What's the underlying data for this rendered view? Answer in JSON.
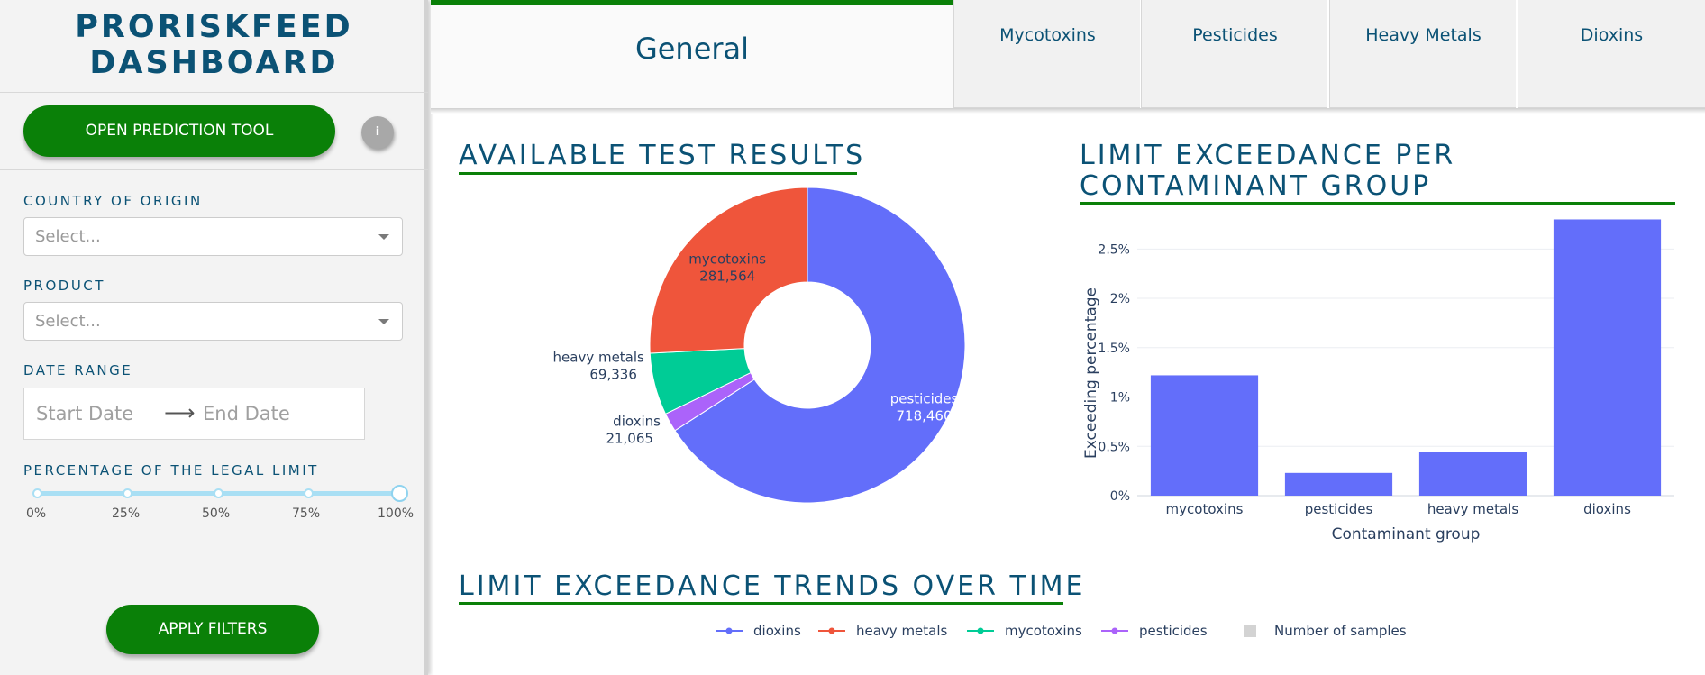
{
  "sidebar": {
    "brand_line1": "PRORISKFEED",
    "brand_line2": "DASHBOARD",
    "prediction_button": "OPEN PREDICTION TOOL",
    "info_label": "i",
    "country": {
      "label": "COUNTRY OF ORIGIN",
      "placeholder": "Select..."
    },
    "product": {
      "label": "PRODUCT",
      "placeholder": "Select..."
    },
    "date_range": {
      "label": "DATE RANGE",
      "start_placeholder": "Start Date",
      "end_placeholder": "End Date"
    },
    "legal_limit": {
      "label": "PERCENTAGE OF THE LEGAL LIMIT",
      "marks": [
        "0%",
        "25%",
        "50%",
        "75%",
        "100%"
      ],
      "value": 100
    },
    "apply_button": "APPLY FILTERS"
  },
  "tabs": [
    {
      "label": "General",
      "active": true
    },
    {
      "label": "Mycotoxins",
      "active": false
    },
    {
      "label": "Pesticides",
      "active": false
    },
    {
      "label": "Heavy Metals",
      "active": false
    },
    {
      "label": "Dioxins",
      "active": false
    }
  ],
  "sections": {
    "available_results": "AVAILABLE TEST RESULTS",
    "exceedance_line1": "LIMIT EXCEEDANCE PER",
    "exceedance_line2": "CONTAMINANT GROUP",
    "trends": "LIMIT EXCEEDANCE TRENDS OVER TIME"
  },
  "colors": {
    "brand": "#0b5275",
    "accent_green": "#0a8008",
    "dioxins": "#636efa",
    "heavy_metals": "#ef553b",
    "mycotoxins": "#00cc96",
    "pesticides": "#ab63fa",
    "bar": "#636efa",
    "samples": "#d3d3d3"
  },
  "trend_legend": [
    {
      "label": "dioxins",
      "color": "#636efa",
      "kind": "line"
    },
    {
      "label": "heavy metals",
      "color": "#ef553b",
      "kind": "line"
    },
    {
      "label": "mycotoxins",
      "color": "#00cc96",
      "kind": "line"
    },
    {
      "label": "pesticides",
      "color": "#ab63fa",
      "kind": "line"
    },
    {
      "label": "Number of samples",
      "color": "#d3d3d3",
      "kind": "square"
    }
  ],
  "chart_data": [
    {
      "type": "pie",
      "hole": true,
      "title": "",
      "slices": [
        {
          "label": "pesticides",
          "value": 718460,
          "display": "718,460",
          "color": "#636efa"
        },
        {
          "label": "dioxins",
          "value": 21065,
          "display": "21,065",
          "color": "#ab63fa"
        },
        {
          "label": "heavy metals",
          "value": 69336,
          "display": "69,336",
          "color": "#00cc96"
        },
        {
          "label": "mycotoxins",
          "value": 281564,
          "display": "281,564",
          "color": "#ef553b"
        }
      ]
    },
    {
      "type": "bar",
      "title": "",
      "categories": [
        "mycotoxins",
        "pesticides",
        "heavy metals",
        "dioxins"
      ],
      "values": [
        1.22,
        0.23,
        0.44,
        2.8
      ],
      "xlabel": "Contaminant group",
      "ylabel": "Exceeding percentage",
      "ylim": [
        0,
        2.85
      ],
      "yticks": [
        0,
        0.5,
        1,
        1.5,
        2,
        2.5
      ],
      "ytick_labels": [
        "0%",
        "0.5%",
        "1%",
        "1.5%",
        "2%",
        "2.5%"
      ],
      "grid": true
    }
  ]
}
